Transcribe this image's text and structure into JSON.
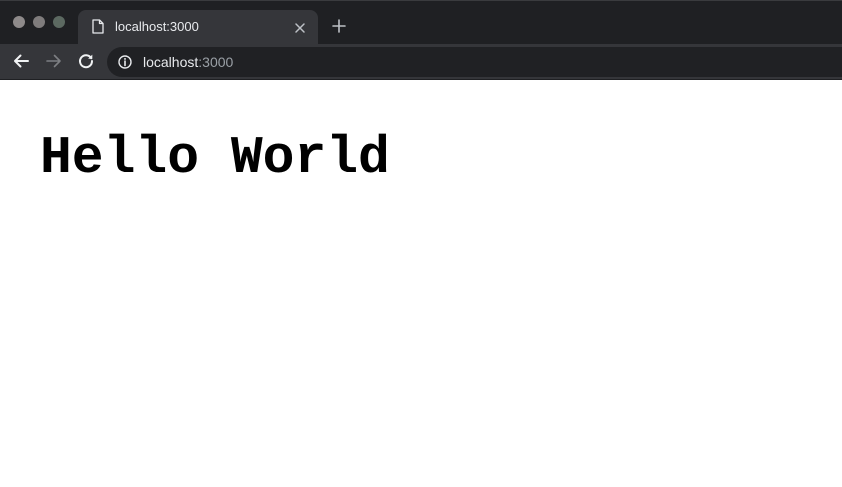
{
  "browser": {
    "tab": {
      "title": "localhost:3000"
    },
    "address_bar": {
      "host": "localhost",
      "port": ":3000"
    }
  },
  "page": {
    "heading": "Hello World"
  },
  "icons": {
    "tab_favicon": "document-icon",
    "tab_close": "close-icon",
    "new_tab": "plus-icon",
    "back": "arrow-left-icon",
    "forward": "arrow-right-icon",
    "reload": "reload-icon",
    "site_info": "info-icon"
  },
  "colors": {
    "tabstrip_bg": "#1f2023",
    "toolbar_bg": "#35363a",
    "omnibox_bg": "#202124",
    "url_host": "#e8eaed",
    "url_port": "#9aa0a6",
    "page_bg": "#ffffff",
    "heading_text": "#000000"
  }
}
